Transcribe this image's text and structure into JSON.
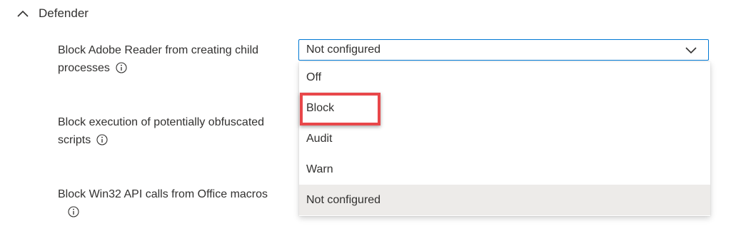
{
  "section": {
    "title": "Defender"
  },
  "settings": [
    {
      "label_line1": "Block Adobe Reader from creating child",
      "label_line2": "processes"
    },
    {
      "label_line1": "Block execution of potentially obfuscated",
      "label_line2": "scripts"
    },
    {
      "label_line1": "Block Win32 API calls from Office macros"
    }
  ],
  "dropdown": {
    "selected_value": "Not configured",
    "options": [
      "Off",
      "Block",
      "Audit",
      "Warn",
      "Not configured"
    ]
  },
  "annotation": {
    "highlighted_option": "Block",
    "color": "#e8474a"
  },
  "colors": {
    "accent": "#0078d4",
    "selected_option_bg": "#edebe9",
    "text": "#323130"
  },
  "icons": {
    "section_toggle": "chevron-up-icon",
    "dropdown_toggle": "chevron-down-icon",
    "info": "info-icon"
  }
}
